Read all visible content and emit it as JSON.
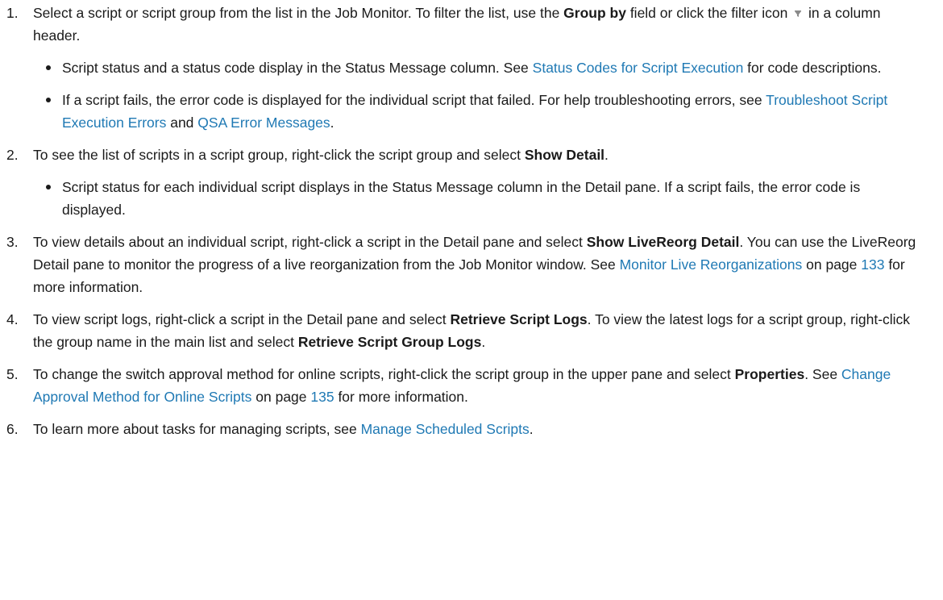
{
  "steps": [
    {
      "num": "1.",
      "t1": "Select a script or script group from the list in the Job Monitor. To filter the list, use the ",
      "b1": "Group by",
      "t2": " field or click the filter icon ",
      "t3": " in a column header.",
      "bullets": [
        {
          "t1": "Script status and a status code display in the Status Message column. See ",
          "link1": "Status Codes for Script Execution",
          "t2": " for code descriptions."
        },
        {
          "t1": "If a script fails, the error code is displayed for the individual script that failed. For help troubleshooting errors, see ",
          "link1": "Troubleshoot Script Execution Errors",
          "t2": " and ",
          "link2": "QSA Error Messages",
          "t3": "."
        }
      ]
    },
    {
      "num": "2.",
      "t1": "To see the list of scripts in a script group, right-click the script group and select ",
      "b1": "Show Detail",
      "t2": ".",
      "bullets": [
        {
          "t1": "Script status for each individual script displays in the Status Message column in the Detail pane. If a script fails, the error code is displayed."
        }
      ]
    },
    {
      "num": "3.",
      "t1": "To view details about an individual script, right-click a script in the Detail pane and select ",
      "b1": "Show LiveReorg Detail",
      "t2": ". You can use the LiveReorg Detail pane to monitor the progress of a live reorganization from the Job Monitor window. See ",
      "link1": "Monitor Live Reorganizations",
      "t3": " on page ",
      "link2": "133",
      "t4": " for more information."
    },
    {
      "num": "4.",
      "t1": "To view script logs, right-click a script in the Detail pane and select ",
      "b1": "Retrieve Script Logs",
      "t2": ". To view the latest logs for a script group, right-click the group name in the main list and select ",
      "b2": "Retrieve Script Group Logs",
      "t3": "."
    },
    {
      "num": "5.",
      "t1": "To change the switch approval method for online scripts, right-click the script group in the upper pane and select ",
      "b1": "Properties",
      "t2": ". See ",
      "link1": "Change Approval Method for Online Scripts",
      "t3": " on page ",
      "link2": "135",
      "t4": " for more information."
    },
    {
      "num": "6.",
      "t1": "To learn more about tasks for managing scripts, see ",
      "link1": "Manage Scheduled Scripts",
      "t2": "."
    }
  ],
  "colors": {
    "text": "#1a1a1a",
    "link": "#1f79b4"
  },
  "icons": [
    "filter-icon"
  ]
}
